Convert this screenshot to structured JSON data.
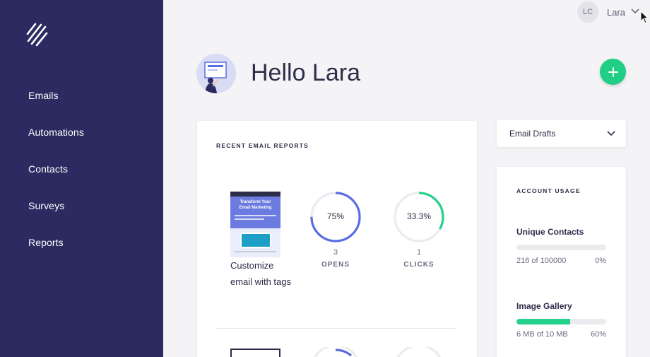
{
  "sidebar": {
    "items": [
      {
        "label": "Emails"
      },
      {
        "label": "Automations"
      },
      {
        "label": "Contacts"
      },
      {
        "label": "Surveys"
      },
      {
        "label": "Reports"
      }
    ]
  },
  "topbar": {
    "initials": "LC",
    "user_name": "Lara"
  },
  "greeting": "Hello Lara",
  "reports": {
    "title": "RECENT EMAIL REPORTS",
    "items": [
      {
        "name": "Customize email with tags",
        "thumbnail_headline": "Transform Your Email Marketing",
        "opens": {
          "percent": 75,
          "percent_label": "75%",
          "count": "3",
          "caption": "OPENS"
        },
        "clicks": {
          "percent": 33.3,
          "percent_label": "33.3%",
          "count": "1",
          "caption": "CLICKS"
        }
      }
    ]
  },
  "drafts": {
    "label": "Email Drafts"
  },
  "usage": {
    "title": "ACCOUNT USAGE",
    "items": [
      {
        "title": "Unique Contacts",
        "detail": "216 of 100000",
        "percent_label": "0%",
        "fraction": 0.0
      },
      {
        "title": "Image Gallery",
        "detail": "6 MB of 10 MB",
        "percent_label": "60%",
        "fraction": 0.6
      }
    ]
  },
  "colors": {
    "sidebar": "#2b2b61",
    "opens_ring": "#5b6ee1",
    "clicks_ring": "#25d08a",
    "add_button": "#1fcf86",
    "usage_bar": "#25d08a"
  },
  "icons": {
    "logo": "slash-lines-logo",
    "add": "plus-icon",
    "dropdown": "chevron-down-icon"
  }
}
